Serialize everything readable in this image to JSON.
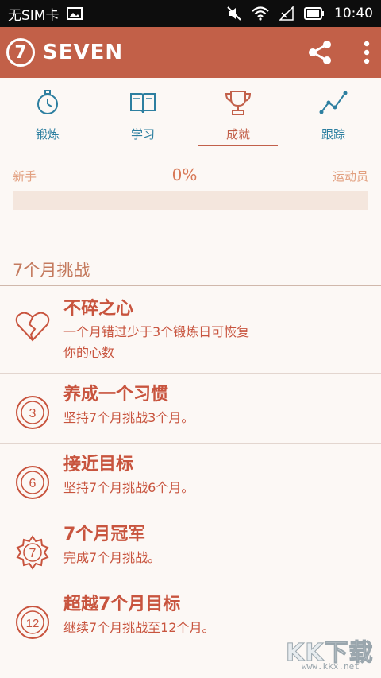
{
  "status_bar": {
    "carrier": "无SIM卡",
    "time": "10:40"
  },
  "app_bar": {
    "logo_digit": "7",
    "title": "SEVEN"
  },
  "tabs": [
    {
      "label": "锻炼",
      "icon": "stopwatch-icon"
    },
    {
      "label": "学习",
      "icon": "book-icon"
    },
    {
      "label": "成就",
      "icon": "trophy-icon",
      "active": true
    },
    {
      "label": "跟踪",
      "icon": "trend-line-icon"
    }
  ],
  "progress": {
    "left_label": "新手",
    "percent_label": "0%",
    "right_label": "运动员",
    "value": 0
  },
  "section_title": "7个月挑战",
  "achievements": [
    {
      "icon": "broken-heart-icon",
      "title": "不碎之心",
      "description_line1": "一个月错过少于3个锻炼日可恢复",
      "description_line2": "你的心数"
    },
    {
      "icon": "badge-3-icon",
      "badge": "3",
      "title": "养成一个习惯",
      "description_line1": "坚持7个月挑战3个月。"
    },
    {
      "icon": "badge-6-icon",
      "badge": "6",
      "title": "接近目标",
      "description_line1": "坚持7个月挑战6个月。"
    },
    {
      "icon": "badge-7-icon",
      "badge": "7",
      "title": "7个月冠军",
      "description_line1": "完成7个月挑战。"
    },
    {
      "icon": "badge-12-icon",
      "badge": "12",
      "title": "超越7个月目标",
      "description_line1": "继续7个月挑战至12个月。"
    }
  ],
  "watermark": {
    "text": "KK下载",
    "url": "www.kkx.net"
  },
  "colors": {
    "accent": "#c26048",
    "tab_inactive": "#2d7fa0",
    "achievement_text": "#c8543e"
  }
}
